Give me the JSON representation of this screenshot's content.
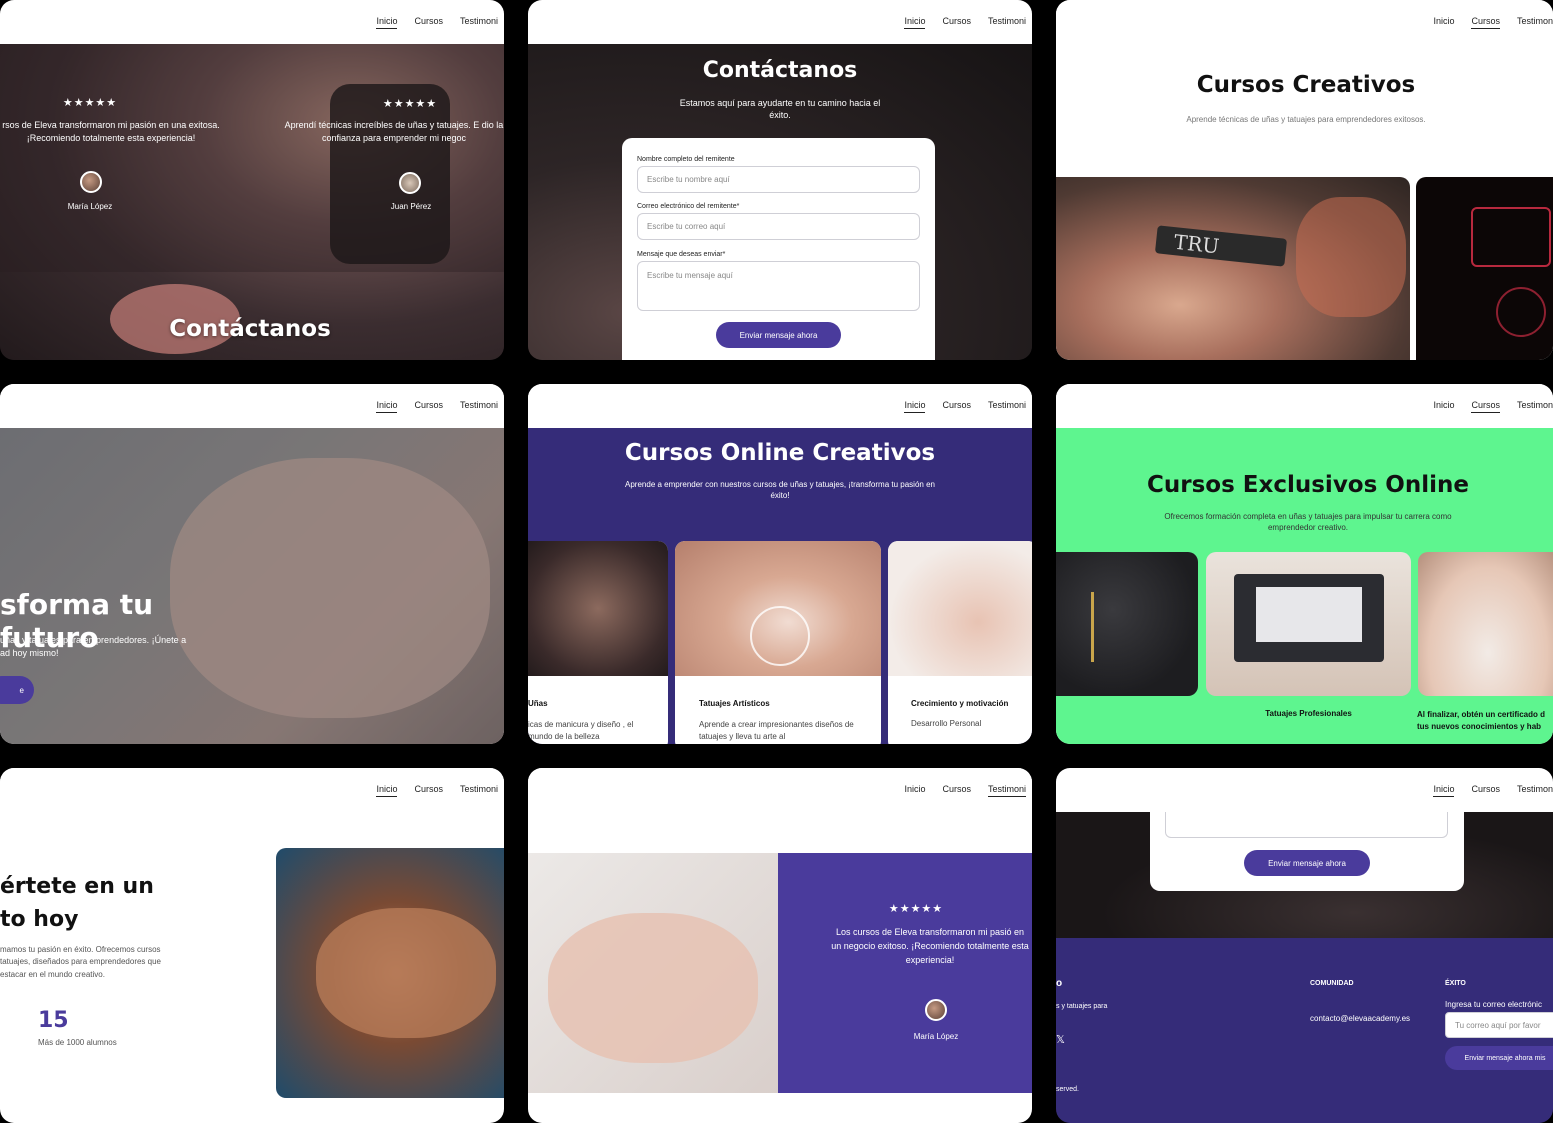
{
  "nav": {
    "inicio": "Inicio",
    "cursos": "Cursos",
    "testimon": "Testimoni"
  },
  "p1": {
    "stars1": "★★★★★",
    "quote1": "rsos de Eleva transformaron mi pasión en una exitosa. ¡Recomiendo totalmente esta experiencia!",
    "name1": "María López",
    "stars2": "★★★★★",
    "quote2": "Aprendí técnicas increíbles de uñas y tatuajes. E dio la confianza para emprender mi negoc",
    "name2": "Juan Pérez",
    "bottom_title": "Contáctanos"
  },
  "p2": {
    "title": "Contáctanos",
    "subtitle": "Estamos aquí para ayudarte en tu camino hacia el éxito.",
    "name_label": "Nombre completo del remitente",
    "name_placeholder": "Escribe tu nombre aquí",
    "email_label": "Correo electrónico del remitente*",
    "email_placeholder": "Escribe tu correo aquí",
    "msg_label": "Mensaje que deseas enviar*",
    "msg_placeholder": "Escribe tu mensaje aquí",
    "submit": "Enviar mensaje ahora"
  },
  "p3": {
    "title": "Cursos Creativos",
    "subtitle": "Aprende técnicas de uñas y tatuajes para emprendedores exitosos.",
    "img_text": "TRU"
  },
  "p4": {
    "title": "sforma tu futuro",
    "subtitle": "uñas y tatuajes para emprendedores. ¡Únete a ad hoy mismo!",
    "cta": "e"
  },
  "p5": {
    "title": "Cursos Online Creativos",
    "subtitle": "Aprende a emprender con nuestros cursos de uñas y tatuajes, ¡transforma tu pasión en éxito!",
    "card1_title": "Uñas",
    "card1_text": "icas de manicura y diseño , el mundo de la belleza",
    "card2_title": "Tatuajes Artísticos",
    "card2_text": "Aprende a crear impresionantes diseños de tatuajes y lleva tu arte al",
    "card3_title": "Crecimiento y motivación",
    "card3_text": "Desarrollo Personal"
  },
  "p6": {
    "title": "Cursos Exclusivos Online",
    "subtitle": "Ofrecemos formación completa en uñas y tatuajes para impulsar tu carrera como emprendedor creativo.",
    "card2_title": "Tatuajes Profesionales",
    "card3_title": "Al finalizar, obtén un certificado d tus nuevos conocimientos y hab"
  },
  "p7": {
    "title_line1": "értete en un",
    "title_line2": "to hoy",
    "text": "mamos tu pasión en éxito. Ofrecemos cursos tatuajes, diseñados para emprendedores que estacar en el mundo creativo.",
    "stat": "15",
    "stat_label": "Más de 1000 alumnos"
  },
  "p8": {
    "stars": "★★★★★",
    "quote": "Los cursos de Eleva transformaron mi pasió en un negocio exitoso. ¡Recomiendo totalmente esta experiencia!",
    "name": "María López"
  },
  "p9": {
    "submit": "Enviar mensaje ahora",
    "brand_frag": "o",
    "about_frag": "s y tatuajes para",
    "community_head": "COMUNIDAD",
    "email": "contacto@elevaacademy.es",
    "success_head": "ÉXITO",
    "newsletter_label": "Ingresa tu correo electrónic",
    "newsletter_placeholder": "Tu correo aquí por favor",
    "newsletter_btn": "Enviar mensaje ahora mis",
    "rights": "served.",
    "x_icon": "𝕏"
  },
  "colors": {
    "purple": "#4a3b9c",
    "deep_purple": "#352c79",
    "mint": "#5ef58f"
  }
}
